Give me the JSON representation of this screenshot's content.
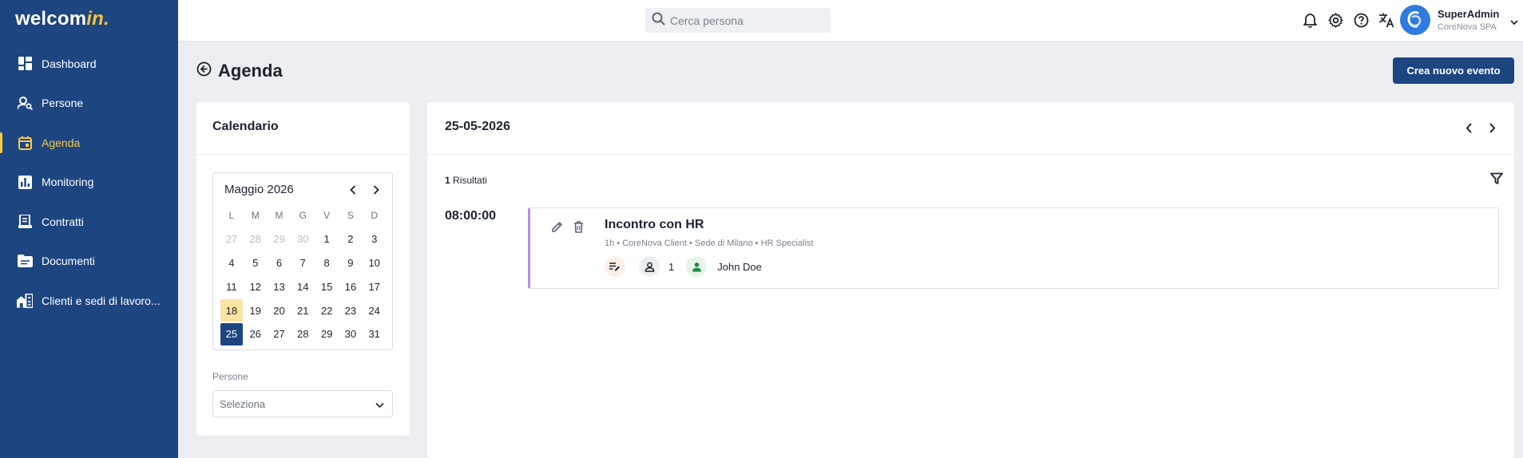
{
  "app": {
    "logo_main": "welcom",
    "logo_accent": "in."
  },
  "sidebar": {
    "items": [
      {
        "label": "Dashboard",
        "icon": "dashboard-icon",
        "active": false
      },
      {
        "label": "Persone",
        "icon": "person-search-icon",
        "active": false
      },
      {
        "label": "Agenda",
        "icon": "calendar-icon",
        "active": true
      },
      {
        "label": "Monitoring",
        "icon": "chart-icon",
        "active": false
      },
      {
        "label": "Contratti",
        "icon": "contract-icon",
        "active": false
      },
      {
        "label": "Documenti",
        "icon": "folder-icon",
        "active": false
      },
      {
        "label": "Clienti e sedi di lavoro...",
        "icon": "buildings-icon",
        "active": false
      }
    ]
  },
  "topbar": {
    "search_placeholder": "Cerca persona",
    "user_name": "SuperAdmin",
    "user_company": "CoreNova SPA"
  },
  "page": {
    "title": "Agenda",
    "create_button": "Crea nuovo evento"
  },
  "calendar": {
    "title": "Calendario",
    "month": "Maggio",
    "year": "2026",
    "weekdays": [
      "L",
      "M",
      "M",
      "G",
      "V",
      "S",
      "D"
    ],
    "days": [
      [
        "27",
        "28",
        "29",
        "30",
        "1",
        "2",
        "3"
      ],
      [
        "4",
        "5",
        "6",
        "7",
        "8",
        "9",
        "10"
      ],
      [
        "11",
        "12",
        "13",
        "14",
        "15",
        "16",
        "17"
      ],
      [
        "18",
        "19",
        "20",
        "21",
        "22",
        "23",
        "24"
      ],
      [
        "25",
        "26",
        "27",
        "28",
        "29",
        "30",
        "31"
      ]
    ],
    "today": "18",
    "selected": "25",
    "persons_label": "Persone",
    "persons_placeholder": "Seleziona"
  },
  "events_panel": {
    "date": "25-05-2026",
    "results_count": "1",
    "results_label": "Risultati",
    "events": [
      {
        "time": "08:00:00",
        "title": "Incontro con HR",
        "meta": "1h • CoreNova Client • Sede di Milano • HR Specialist",
        "participants_count": "1",
        "person": "John Doe",
        "accent_color": "#b58ee8"
      }
    ]
  },
  "colors": {
    "brand": "#1d4580",
    "accent": "#f7c948",
    "today_highlight": "#fbe3a1"
  }
}
